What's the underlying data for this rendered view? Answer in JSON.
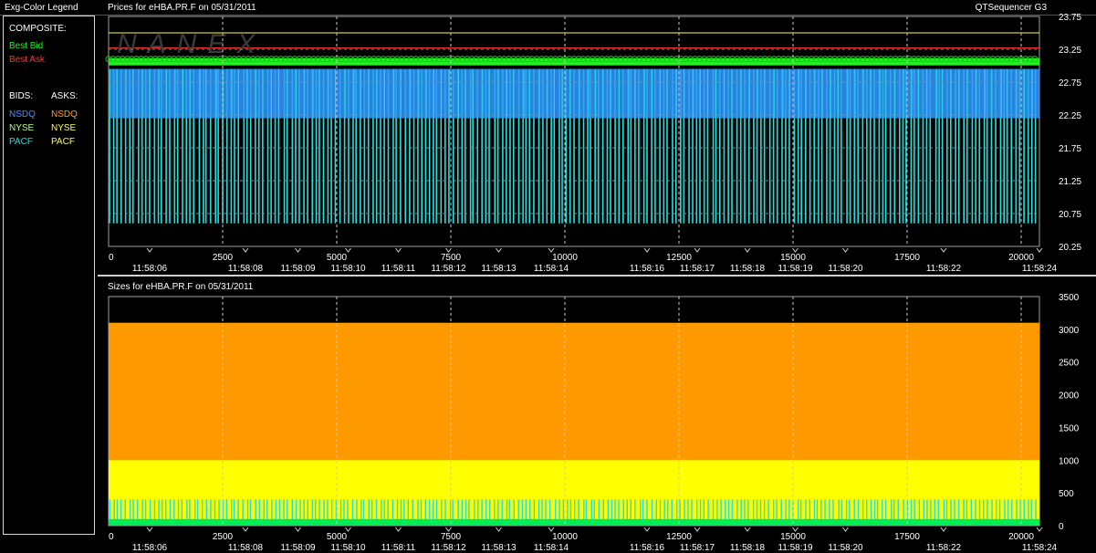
{
  "legend": {
    "title": "Exg-Color Legend",
    "composite_label": "COMPOSITE:",
    "best_bid": "Best Bid",
    "best_ask": "Best Ask",
    "bids_label": "BIDS:",
    "asks_label": "ASKS:",
    "bids": [
      {
        "label": "NSDQ",
        "color": "#3f8fff"
      },
      {
        "label": "NYSE",
        "color": "#b0ff7a"
      },
      {
        "label": "PACF",
        "color": "#20e0e0"
      }
    ],
    "asks": [
      {
        "label": "NSDQ",
        "color": "#ff9a30"
      },
      {
        "label": "NYSE",
        "color": "#ffff40"
      },
      {
        "label": "PACF",
        "color": "#ffff40"
      }
    ],
    "colors": {
      "best_bid": "#22ee22",
      "best_ask": "#ff3030"
    }
  },
  "header": {
    "prices_title": "Prices for  eHBA.PR.F  on  05/31/2011",
    "app_name": "QTSequencer G3",
    "sizes_title": "Sizes for  eHBA.PR.F  on  05/31/2011"
  },
  "watermark": "NANEX",
  "chart_data": [
    {
      "type": "line",
      "panel": "prices",
      "x_ticks": [
        0,
        2500,
        5000,
        7500,
        10000,
        12500,
        15000,
        17500,
        20000
      ],
      "xlim": [
        0,
        20400
      ],
      "time_labels": [
        {
          "x": 900,
          "label": "11:58:06"
        },
        {
          "x": 3000,
          "label": "11:58:08"
        },
        {
          "x": 4150,
          "label": "11:58:09"
        },
        {
          "x": 5250,
          "label": "11:58:10"
        },
        {
          "x": 6350,
          "label": "11:58:11"
        },
        {
          "x": 7450,
          "label": "11:58:12"
        },
        {
          "x": 8550,
          "label": "11:58:13"
        },
        {
          "x": 9700,
          "label": "11:58:14"
        },
        {
          "x": 11800,
          "label": "11:58:16"
        },
        {
          "x": 12900,
          "label": "11:58:17"
        },
        {
          "x": 14000,
          "label": "11:58:18"
        },
        {
          "x": 15050,
          "label": "11:58:19"
        },
        {
          "x": 16150,
          "label": "11:58:20"
        },
        {
          "x": 18300,
          "label": "11:58:22"
        },
        {
          "x": 20400,
          "label": "11:58:24"
        }
      ],
      "y_ticks": [
        20.25,
        20.75,
        21.25,
        21.75,
        22.25,
        22.75,
        23.25,
        23.75
      ],
      "ylim": [
        20.25,
        23.75
      ],
      "series": [
        {
          "name": "Best Ask",
          "color": "#ffff40",
          "value": 23.5
        },
        {
          "name": "Best Bid",
          "color": "#22ee22",
          "value": 23.06
        },
        {
          "name": "NSDQ",
          "color": "#3399ff",
          "low": 22.2,
          "high": 22.95
        },
        {
          "name": "PACF",
          "color": "#20e0e0",
          "low": 20.6,
          "high": 22.95
        }
      ]
    },
    {
      "type": "area",
      "panel": "sizes",
      "x_ticks": [
        0,
        2500,
        5000,
        7500,
        10000,
        12500,
        15000,
        17500,
        20000
      ],
      "xlim": [
        0,
        20400
      ],
      "y_ticks": [
        0,
        500,
        1000,
        1500,
        2000,
        2500,
        3000,
        3500
      ],
      "ylim": [
        0,
        3500
      ],
      "series": [
        {
          "name": "NSDQ",
          "color": "#ff9900",
          "value": 3100
        },
        {
          "name": "NYSE",
          "color": "#ffff00",
          "value": 1000
        },
        {
          "name": "PACF",
          "color": "#20e0e0",
          "value": 400
        },
        {
          "name": "Best Bid",
          "color": "#00ee55",
          "value": 100
        }
      ]
    }
  ]
}
